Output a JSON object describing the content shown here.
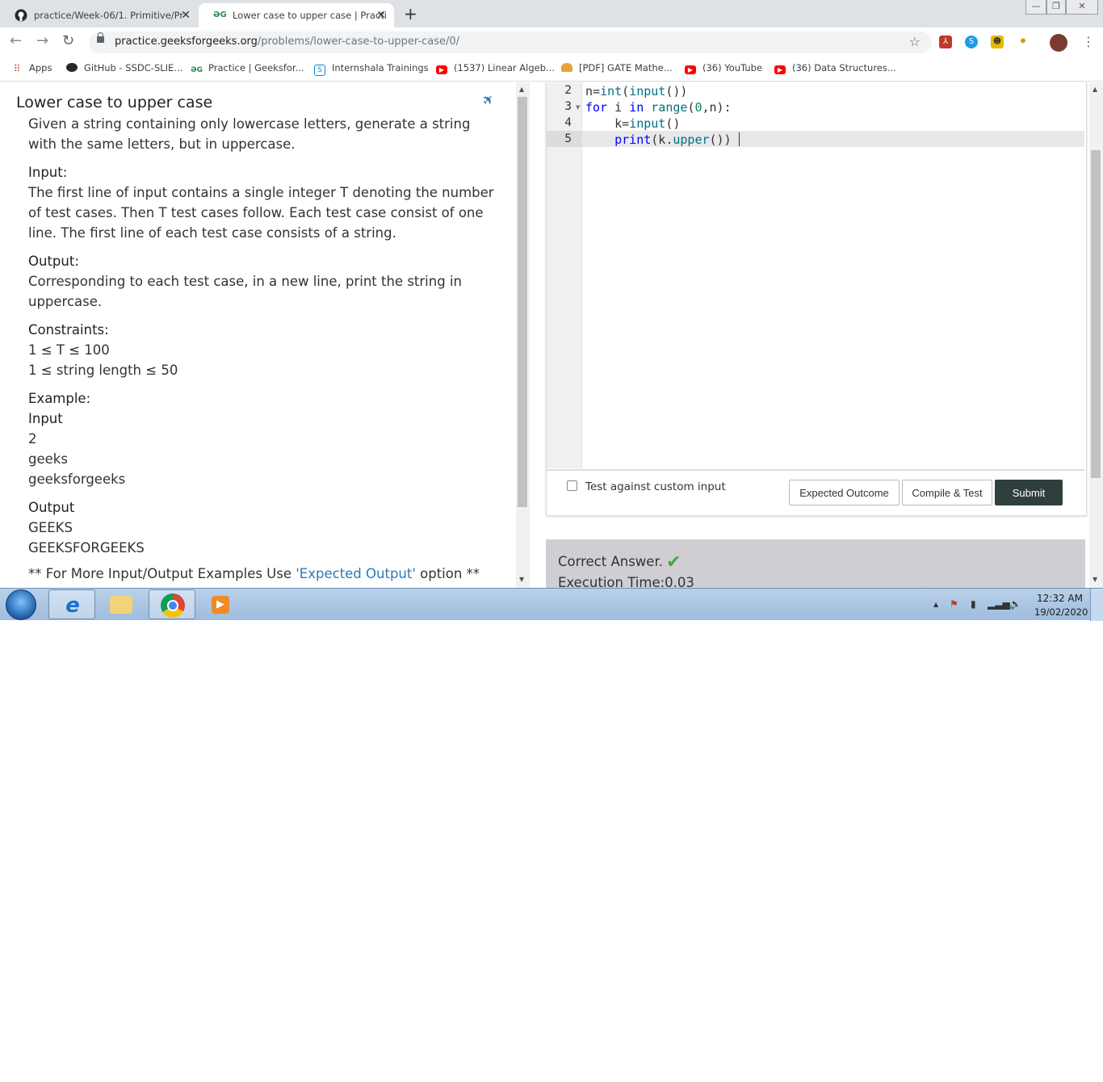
{
  "browser": {
    "tabs": [
      {
        "title": "practice/Week-06/1. Primitive/Pr",
        "icon": "github-icon"
      },
      {
        "title": "Lower case to upper case | Practi",
        "icon": "gfg-icon"
      }
    ],
    "new_tab": "+",
    "url_host": "practice.geeksforgeeks.org",
    "url_path": "/problems/lower-case-to-upper-case/0/",
    "bookmarks": [
      {
        "label": "Apps",
        "icon": "apps-grid-icon",
        "color": "#e8453c"
      },
      {
        "label": "GitHub - SSDC-SLIE...",
        "icon": "github-icon",
        "color": "#24292e"
      },
      {
        "label": "Practice | Geeksfor...",
        "icon": "gfg-icon",
        "color": "#2f8d46"
      },
      {
        "label": "Internshala Trainings",
        "icon": "internshala-icon",
        "color": "#008bdc"
      },
      {
        "label": "(1537) Linear Algeb...",
        "icon": "youtube-icon",
        "color": "#ff0000"
      },
      {
        "label": "[PDF] GATE Mathe...",
        "icon": "person-icon",
        "color": "#e8a33b"
      },
      {
        "label": "(36) YouTube",
        "icon": "youtube-icon",
        "color": "#ff0000"
      },
      {
        "label": "(36) Data Structures...",
        "icon": "youtube-icon",
        "color": "#ff0000"
      }
    ]
  },
  "problem": {
    "title": "Lower case to upper case",
    "description": "Given a string containing only lowercase letters, generate a string with the same letters, but in uppercase.",
    "input_heading": "Input:",
    "input_text": "The first line of input contains a single integer T denoting the number of test cases. Then T test cases follow. Each test case consist of one line. The first line of each test case consists of a string.",
    "output_heading": "Output:",
    "output_text": "Corresponding to each test case, in a new line, print the string in uppercase.",
    "constraints_heading": "Constraints:",
    "constraints": [
      "1 ≤ T ≤ 100",
      "1 ≤ string length ≤ 50"
    ],
    "example_heading": "Example:",
    "example_input_heading": "Input",
    "example_input": [
      "2",
      "geeks",
      "geeksforgeeks"
    ],
    "example_output_heading": "Output",
    "example_output": [
      "GEEKS",
      "GEEKSFORGEEKS"
    ],
    "footer_prefix": "** For More Input/Output Examples Use ",
    "footer_link": "'Expected Output'",
    "footer_suffix": " option **"
  },
  "editor": {
    "line_numbers": [
      "2",
      "3",
      "4",
      "5"
    ],
    "custom_input_label": "Test against custom input",
    "custom_input_checked": false,
    "buttons": {
      "expected": "Expected Outcome",
      "compile": "Compile & Test",
      "submit": "Submit"
    }
  },
  "result": {
    "status": "Correct Answer.",
    "execution": "Execution Time:0.03"
  },
  "taskbar": {
    "time": "12:32 AM",
    "date": "19/02/2020"
  },
  "colors": {
    "accent": "#2f3f3e",
    "link": "#2b7bb9",
    "keyword": "#0000ff",
    "success": "#47a447"
  }
}
